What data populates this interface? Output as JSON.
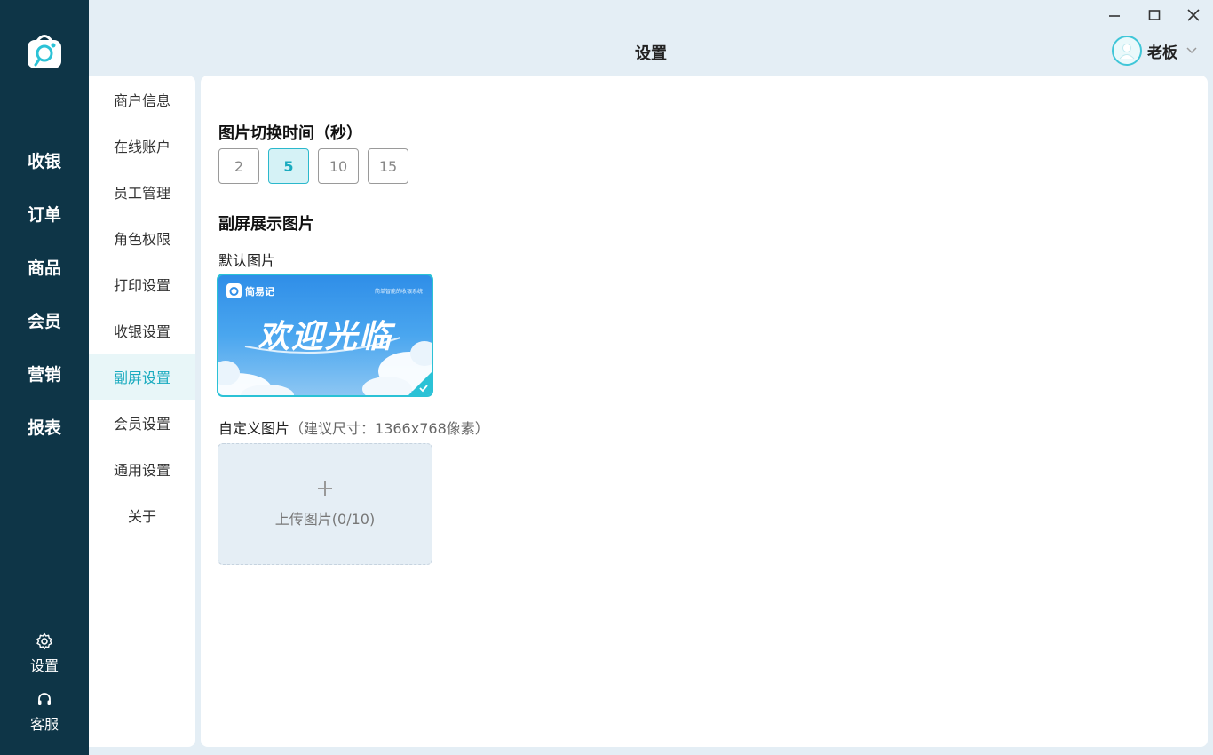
{
  "window": {
    "title": "设置"
  },
  "rail": {
    "items": [
      {
        "label": "收银"
      },
      {
        "label": "订单"
      },
      {
        "label": "商品"
      },
      {
        "label": "会员"
      },
      {
        "label": "营销"
      },
      {
        "label": "报表"
      }
    ],
    "settings_label": "设置",
    "support_label": "客服"
  },
  "user": {
    "name": "老板"
  },
  "menu": {
    "items": [
      {
        "label": "商户信息"
      },
      {
        "label": "在线账户"
      },
      {
        "label": "员工管理"
      },
      {
        "label": "角色权限"
      },
      {
        "label": "打印设置"
      },
      {
        "label": "收银设置"
      },
      {
        "label": "副屏设置",
        "active": true
      },
      {
        "label": "会员设置"
      },
      {
        "label": "通用设置"
      },
      {
        "label": "关于"
      }
    ]
  },
  "content": {
    "switch_title": "图片切换时间（秒）",
    "switch_options": [
      "2",
      "5",
      "10",
      "15"
    ],
    "switch_selected": "5",
    "display_title": "副屏展示图片",
    "default_label": "默认图片",
    "default_image": {
      "brand_text": "简易记",
      "tagline": "简单智能的收银系统",
      "welcome_text": "欢迎光临"
    },
    "custom_label": "自定义图片",
    "custom_hint": "（建议尺寸：1366x768像素）",
    "upload_text": "上传图片(0/10)"
  },
  "colors": {
    "rail": "#0e3547",
    "accent": "#2bc2d6",
    "background": "#e4eef5"
  }
}
